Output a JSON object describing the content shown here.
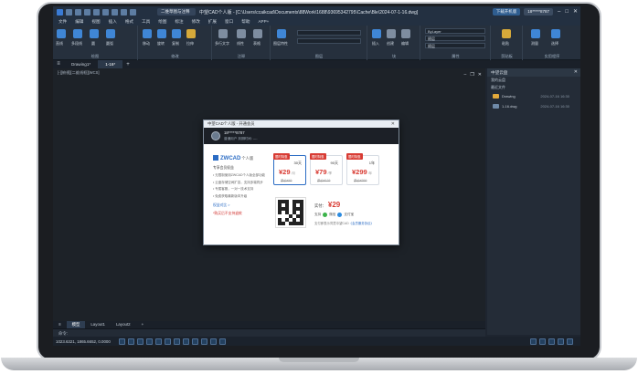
{
  "titlebar": {
    "doc_tab": "二维草图与注释",
    "title": "中望CAD个人版 - [C:\\Users\\ccaikcad\\Documents\\88Work\\1688\\93695342795\\Cache\\Ble\\2024-07-1-16.dwg]",
    "upgrade_label": "下载开机版",
    "user_label": "18*****8787"
  },
  "menu": [
    "文件",
    "编辑",
    "视图",
    "插入",
    "格式",
    "工具",
    "绘图",
    "标注",
    "修改",
    "扩展",
    "窗口",
    "帮助",
    "APP+"
  ],
  "ribbon": {
    "groups": [
      "绘图",
      "修改",
      "注释",
      "图层",
      "块",
      "属性",
      "剪贴板",
      "实用程序"
    ],
    "draw_tools": [
      "直线",
      "多段线",
      "圆",
      "圆弧"
    ],
    "modify_tools": [
      "移动",
      "旋转",
      "复制",
      "拉伸"
    ],
    "annot_tools": [
      "多行文字",
      "线性",
      "表格"
    ],
    "layer_tools": [
      "图层特性"
    ],
    "block_tools": [
      "插入",
      "创建",
      "编辑"
    ],
    "props": [
      "ByLayer",
      "随层",
      "随层"
    ],
    "clip_tools": [
      "粘贴"
    ],
    "util_tools": [
      "测量",
      "选择"
    ]
  },
  "tabs": {
    "items": [
      "Drawing1*",
      "1-16*"
    ],
    "active_index": 1,
    "view_label": "[-][俯视][二维线框][WCS]"
  },
  "right_panel": {
    "title": "中望云盘",
    "rows": [
      "我的云盘",
      "最近文件"
    ],
    "files": [
      {
        "name": "Drawing",
        "date": "2024-07-16 16:30"
      },
      {
        "name": "1-16.dwg",
        "date": "2024-07-16 16:30"
      }
    ]
  },
  "layouts": [
    "模型",
    "Layout1",
    "Layout2"
  ],
  "active_layout": 0,
  "cmdline": "命令:",
  "statusbar": {
    "coords": "1023.6321, 1865.6652, 0.0000"
  },
  "dialog": {
    "title": "中望CAD个人版 - 开通会员",
    "user_name": "18*****8787",
    "user_sub": "普通用户  到期时间: ----",
    "logo_brand": "ZWCAD",
    "logo_edition": "个人版",
    "perk_title": "专享会员权益",
    "perks": [
      "• 无限制使用ZWCAD个人版全部功能",
      "• 云盘存储空间扩容，支持多端同步",
      "• 专属客服，一对一技术支持",
      "• 免费获取最新版本升级"
    ],
    "link": "权益对比 >",
    "warning": "*购买后不支持退款",
    "plans": [
      {
        "tag": "限时特惠",
        "duration": "30天",
        "price": "¥29",
        "unit": "/月",
        "orig": "原价¥49"
      },
      {
        "tag": "限时特惠",
        "duration": "90天",
        "price": "¥79",
        "unit": "/季",
        "orig": "原价¥129"
      },
      {
        "tag": "限时特惠",
        "duration": "1年",
        "price": "¥299",
        "unit": "/年",
        "orig": "原价¥399"
      }
    ],
    "selected_plan": 0,
    "pay_label": "实付：",
    "pay_amount": "¥29",
    "pay_methods_label": "支持",
    "pay_wechat": "微信",
    "pay_alipay": "支付宝",
    "pay_agree": "支付即表示同意中望CAD",
    "pay_agree_link": "《会员服务协议》"
  },
  "colors": {
    "accent": "#2b6cc4",
    "price": "#d83b33",
    "tag": "#d83b33"
  }
}
